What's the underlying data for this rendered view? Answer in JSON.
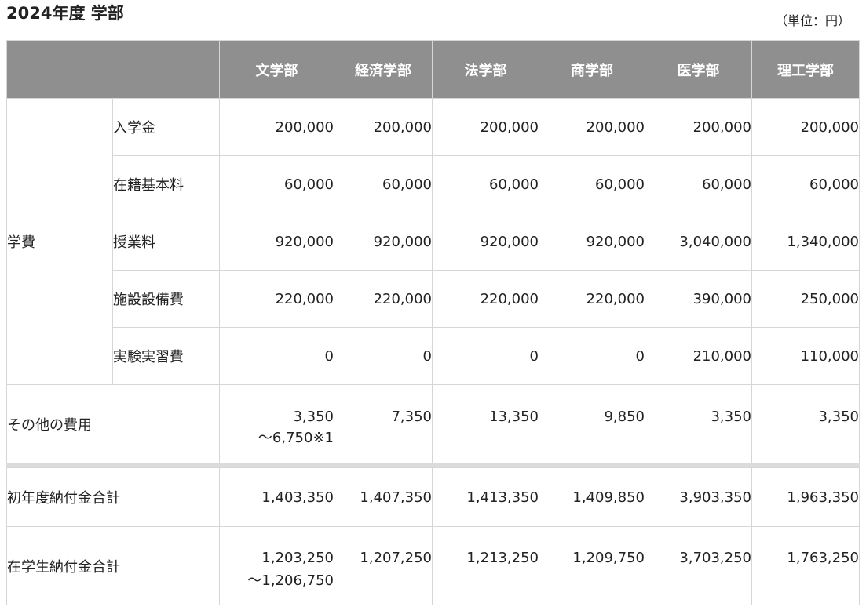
{
  "title": "2024年度 学部",
  "unit_note": "（単位：円）",
  "columns": [
    "文学部",
    "経済学部",
    "法学部",
    "商学部",
    "医学部",
    "理工学部"
  ],
  "tuition": {
    "group_label": "学費",
    "rows": [
      {
        "label": "入学金",
        "values": [
          "200,000",
          "200,000",
          "200,000",
          "200,000",
          "200,000",
          "200,000"
        ]
      },
      {
        "label": "在籍基本料",
        "values": [
          "60,000",
          "60,000",
          "60,000",
          "60,000",
          "60,000",
          "60,000"
        ]
      },
      {
        "label": "授業料",
        "values": [
          "920,000",
          "920,000",
          "920,000",
          "920,000",
          "3,040,000",
          "1,340,000"
        ]
      },
      {
        "label": "施設設備費",
        "values": [
          "220,000",
          "220,000",
          "220,000",
          "220,000",
          "390,000",
          "250,000"
        ]
      },
      {
        "label": "実験実習費",
        "values": [
          "0",
          "0",
          "0",
          "0",
          "210,000",
          "110,000"
        ]
      }
    ]
  },
  "other_fees": {
    "label": "その他の費用",
    "values": [
      {
        "line1": "3,350",
        "line2": "～6,750※1"
      },
      {
        "line1": "7,350",
        "line2": ""
      },
      {
        "line1": "13,350",
        "line2": ""
      },
      {
        "line1": "9,850",
        "line2": ""
      },
      {
        "line1": "3,350",
        "line2": ""
      },
      {
        "line1": "3,350",
        "line2": ""
      }
    ]
  },
  "first_year_total": {
    "label": "初年度納付金合計",
    "values": [
      "1,403,350",
      "1,407,350",
      "1,413,350",
      "1,409,850",
      "3,903,350",
      "1,963,350"
    ]
  },
  "continuing_total": {
    "label": "在学生納付金合計",
    "values": [
      {
        "line1": "1,203,250",
        "line2": "～1,206,750"
      },
      {
        "line1": "1,207,250",
        "line2": ""
      },
      {
        "line1": "1,213,250",
        "line2": ""
      },
      {
        "line1": "1,209,750",
        "line2": ""
      },
      {
        "line1": "3,703,250",
        "line2": ""
      },
      {
        "line1": "1,763,250",
        "line2": ""
      }
    ]
  },
  "colors": {
    "header_bg": "#8f8f8f",
    "header_text": "#ffffff",
    "border": "#d6d6d6",
    "separator": "#dcdcdc"
  }
}
